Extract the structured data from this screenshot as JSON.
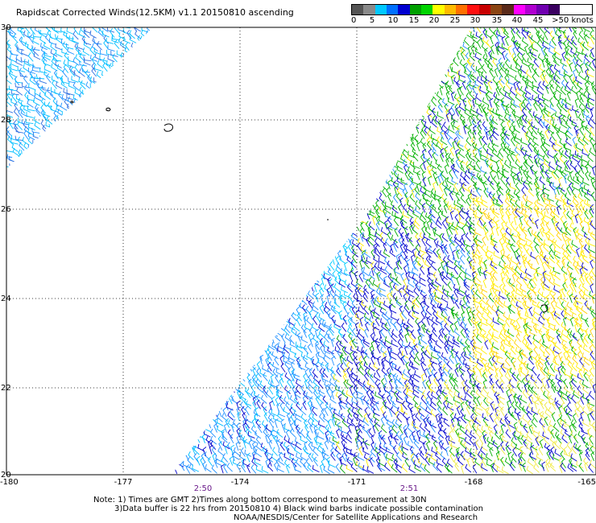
{
  "title": "Rapidscat Corrected Winds(12.5KM) v1.1 20150810 ascending",
  "legend": {
    "colors": [
      "#555555",
      "#8a8a8a",
      "#00c8ff",
      "#0070ff",
      "#0000d0",
      "#00a000",
      "#00d400",
      "#ffff00",
      "#ffbb00",
      "#ff7000",
      "#ff1010",
      "#c80000",
      "#8b4513",
      "#5a2a1a",
      "#ff00ff",
      "#b000d0",
      "#7000b0",
      "#3a0060"
    ],
    "ticks": [
      "0",
      "5",
      "10",
      "15",
      "20",
      "25",
      "30",
      "35",
      "40",
      "45",
      ">50 knots"
    ]
  },
  "map": {
    "lat_labels": [
      "30",
      "28",
      "26",
      "24",
      "22",
      "20"
    ],
    "lon_labels": [
      "-180",
      "-177",
      "-174",
      "-171",
      "-168",
      "-165"
    ],
    "time_labels": [
      "2:50",
      "2:51"
    ]
  },
  "notes": {
    "line1": "Note: 1) Times are GMT 2)Times along bottom correspond to measurement at 30N",
    "line2": "3)Data buffer is 22 hrs from 20150810 4) Black wind barbs indicate possible contamination",
    "line3": "NOAA/NESDIS/Center for Satellite Applications and Research"
  }
}
